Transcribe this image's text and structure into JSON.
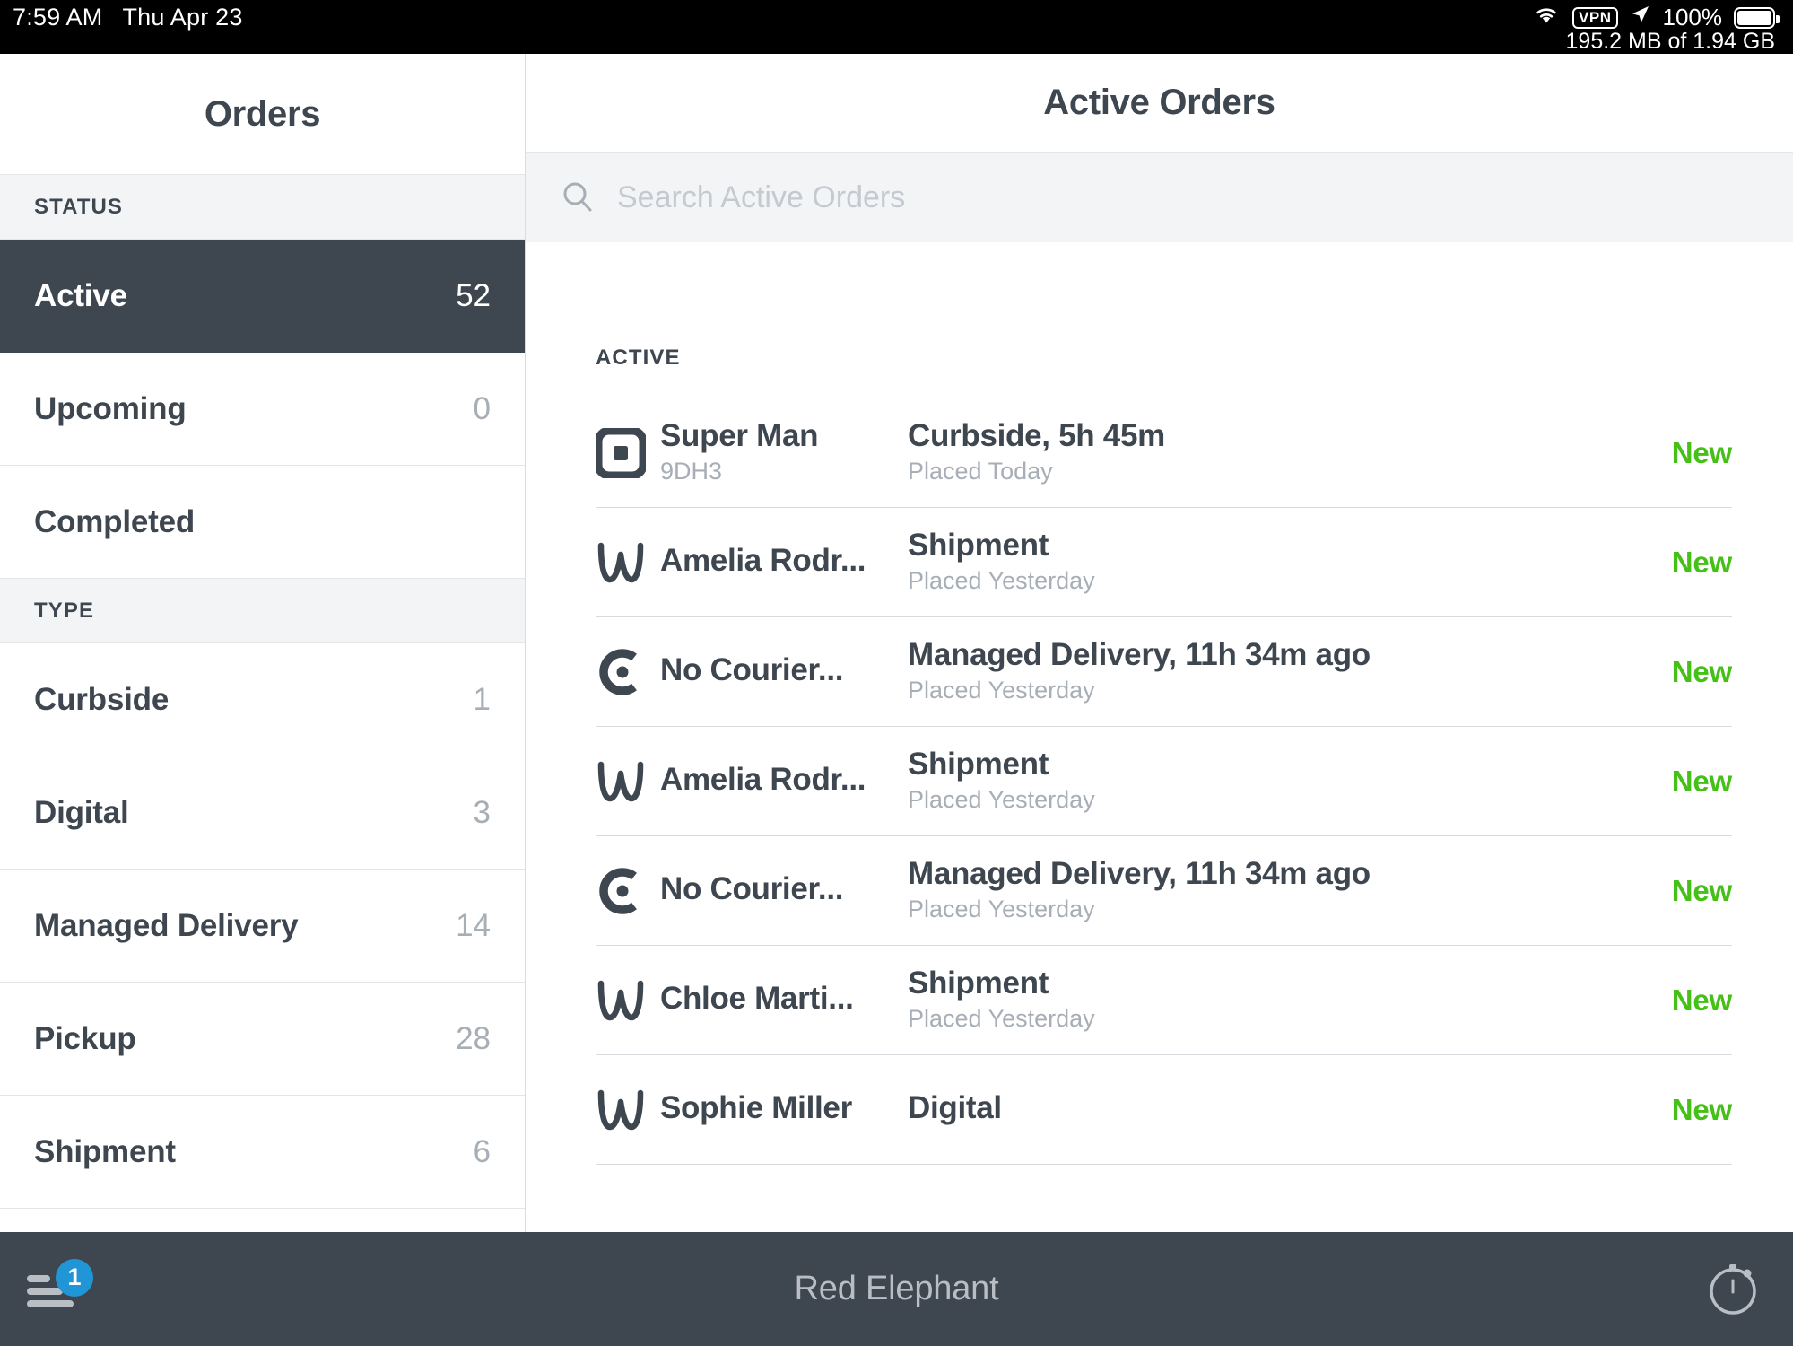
{
  "status_bar": {
    "time": "7:59 AM",
    "date": "Thu Apr 23",
    "wifi_icon": "wifi-icon",
    "vpn_label": "VPN",
    "location_icon": "location-arrow-icon",
    "battery_percent": "100%",
    "storage": "195.2 MB of 1.94 GB"
  },
  "sidebar": {
    "title": "Orders",
    "sections": [
      {
        "header": "STATUS",
        "items": [
          {
            "label": "Active",
            "count": "52",
            "selected": true
          },
          {
            "label": "Upcoming",
            "count": "0",
            "selected": false
          },
          {
            "label": "Completed",
            "count": "",
            "selected": false
          }
        ]
      },
      {
        "header": "TYPE",
        "items": [
          {
            "label": "Curbside",
            "count": "1",
            "selected": false
          },
          {
            "label": "Digital",
            "count": "3",
            "selected": false
          },
          {
            "label": "Managed Delivery",
            "count": "14",
            "selected": false
          },
          {
            "label": "Pickup",
            "count": "28",
            "selected": false
          },
          {
            "label": "Shipment",
            "count": "6",
            "selected": false
          }
        ]
      }
    ]
  },
  "main": {
    "title": "Active Orders",
    "search": {
      "placeholder": "Search Active Orders",
      "value": "",
      "icon": "search-icon"
    },
    "group_label": "ACTIVE",
    "rows": [
      {
        "icon": "square-logo-icon",
        "name": "Super Man",
        "order_id": "9DH3",
        "detail": "Curbside, 5h 45m",
        "placed": "Placed Today",
        "status": "New"
      },
      {
        "icon": "weebly-logo-icon",
        "name": "Amelia Rodr...",
        "order_id": "",
        "detail": "Shipment",
        "placed": "Placed Yesterday",
        "status": "New"
      },
      {
        "icon": "caviar-logo-icon",
        "name": "No Courier...",
        "order_id": "",
        "detail": "Managed Delivery, 11h 34m ago",
        "placed": "Placed Yesterday",
        "status": "New"
      },
      {
        "icon": "weebly-logo-icon",
        "name": "Amelia Rodr...",
        "order_id": "",
        "detail": "Shipment",
        "placed": "Placed Yesterday",
        "status": "New"
      },
      {
        "icon": "caviar-logo-icon",
        "name": "No Courier...",
        "order_id": "",
        "detail": "Managed Delivery, 11h 34m ago",
        "placed": "Placed Yesterday",
        "status": "New"
      },
      {
        "icon": "weebly-logo-icon",
        "name": "Chloe Marti...",
        "order_id": "",
        "detail": "Shipment",
        "placed": "Placed Yesterday",
        "status": "New"
      },
      {
        "icon": "weebly-logo-icon",
        "name": "Sophie Miller",
        "order_id": "",
        "detail": "Digital",
        "placed": "",
        "status": "New"
      }
    ]
  },
  "bottom_bar": {
    "menu_icon": "list-menu-icon",
    "badge_count": "1",
    "title": "Red Elephant",
    "timer_icon": "stopwatch-icon"
  },
  "colors": {
    "dark": "#3e4650",
    "accent_green": "#44c017",
    "badge_blue": "#2196d6",
    "muted": "#a7aeb5",
    "panel": "#f2f4f6"
  }
}
